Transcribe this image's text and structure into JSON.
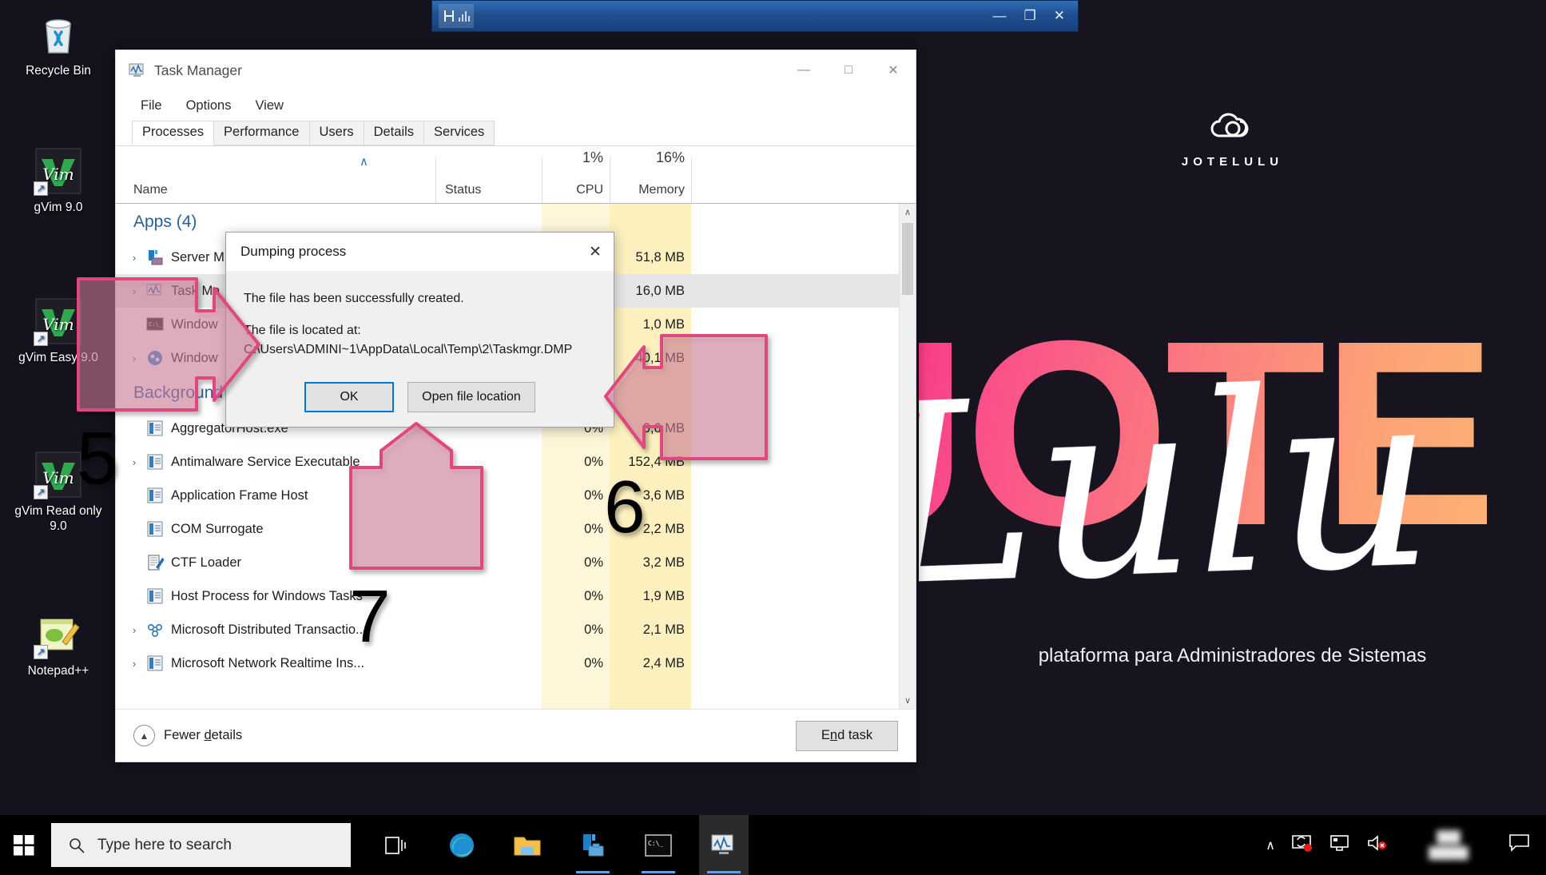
{
  "desktop": {
    "icons": [
      {
        "label": "Recycle Bin",
        "icon": "recycle-bin-icon",
        "shortcut": false
      },
      {
        "label": "gVim 9.0",
        "icon": "gvim-icon",
        "shortcut": true
      },
      {
        "label": "gVim Easy 9.0",
        "icon": "gvim-icon",
        "shortcut": true
      },
      {
        "label": "gVim Read only 9.0",
        "icon": "gvim-icon",
        "shortcut": true
      },
      {
        "label": "Notepad++",
        "icon": "notepadpp-icon",
        "shortcut": true
      }
    ],
    "wallpaper": {
      "brand": "JOTELULU",
      "word_back": "JOTE",
      "word_script": "Lulu",
      "tagline": "plataforma para Administradores de Sistemas",
      "colors": {
        "bg": "#17141f",
        "pink": "#f3237f",
        "peach": "#fdb273"
      }
    }
  },
  "background_window": {
    "title": "",
    "minimize": "—",
    "restore": "❐",
    "close": "✕"
  },
  "task_manager": {
    "title": "Task Manager",
    "window_buttons": {
      "minimize": "—",
      "maximize": "□",
      "close": "✕"
    },
    "menus": [
      "File",
      "Options",
      "View"
    ],
    "tabs": [
      {
        "label": "Processes",
        "active": true
      },
      {
        "label": "Performance",
        "active": false
      },
      {
        "label": "Users",
        "active": false
      },
      {
        "label": "Details",
        "active": false
      },
      {
        "label": "Services",
        "active": false
      }
    ],
    "columns": {
      "name": "Name",
      "status": "Status",
      "cpu": "CPU",
      "memory": "Memory",
      "cpu_total": "1%",
      "memory_total": "16%",
      "sort_indicator": "∧"
    },
    "groups": [
      {
        "label": "Apps (4)"
      },
      {
        "label": "Background p"
      }
    ],
    "apps": [
      {
        "name": "Server M",
        "expand": true,
        "status": "",
        "cpu": "%",
        "memory": "51,8 MB",
        "icon": "server-manager-icon",
        "selected": false
      },
      {
        "name": "Task Ma",
        "expand": true,
        "status": "",
        "cpu": "%",
        "memory": "16,0 MB",
        "icon": "task-manager-icon",
        "selected": true
      },
      {
        "name": "Window",
        "expand": false,
        "status": "",
        "cpu": "%",
        "memory": "1,0 MB",
        "icon": "console-icon",
        "selected": false
      },
      {
        "name": "Window",
        "expand": true,
        "status": "",
        "cpu": "%",
        "memory": "40,1 MB",
        "icon": "powershell-ise-icon",
        "selected": false
      }
    ],
    "background_processes": [
      {
        "name": "AggregatorHost.exe",
        "expand": false,
        "status": "",
        "cpu": "0%",
        "memory": "0,6 MB",
        "icon": "generic-app-icon"
      },
      {
        "name": "Antimalware Service Executable",
        "expand": true,
        "status": "",
        "cpu": "0%",
        "memory": "152,4 MB",
        "icon": "generic-app-icon"
      },
      {
        "name": "Application Frame Host",
        "expand": false,
        "status": "",
        "cpu": "0%",
        "memory": "3,6 MB",
        "icon": "generic-app-icon"
      },
      {
        "name": "COM Surrogate",
        "expand": false,
        "status": "",
        "cpu": "0%",
        "memory": "2,2 MB",
        "icon": "generic-app-icon"
      },
      {
        "name": "CTF Loader",
        "expand": false,
        "status": "",
        "cpu": "0%",
        "memory": "3,2 MB",
        "icon": "ctf-loader-icon"
      },
      {
        "name": "Host Process for Windows Tasks",
        "expand": false,
        "status": "",
        "cpu": "0%",
        "memory": "1,9 MB",
        "icon": "generic-app-icon"
      },
      {
        "name": "Microsoft Distributed Transactio...",
        "expand": true,
        "status": "",
        "cpu": "0%",
        "memory": "2,1 MB",
        "icon": "msdtc-icon"
      },
      {
        "name": "Microsoft Network Realtime Ins...",
        "expand": true,
        "status": "",
        "cpu": "0%",
        "memory": "2,4 MB",
        "icon": "generic-app-icon"
      }
    ],
    "footer": {
      "fewer_details": "Fewer details",
      "fewer_details_pre": "Fewer ",
      "fewer_details_accel": "d",
      "fewer_details_post": "etails",
      "end_task_pre": "E",
      "end_task_accel": "n",
      "end_task_post": "d task",
      "end_task": "End task"
    },
    "scrollbar": {
      "up": "∧",
      "down": "∨"
    }
  },
  "dialog": {
    "title": "Dumping process",
    "close": "✕",
    "line1": "The file has been successfully created.",
    "line2": "The file is located at:",
    "path": "C:\\Users\\ADMINI~1\\AppData\\Local\\Temp\\2\\Taskmgr.DMP",
    "ok_button": "OK",
    "open_location_button": "Open file location"
  },
  "annotations": [
    {
      "number": "5",
      "direction": "right",
      "target": "apps-process-list"
    },
    {
      "number": "6",
      "direction": "left",
      "target": "open-file-location-button"
    },
    {
      "number": "7",
      "direction": "up",
      "target": "ok-button"
    }
  ],
  "taskbar": {
    "start": "start-button",
    "search_placeholder": "Type here to search",
    "items": [
      {
        "name": "task-view-icon",
        "active": false,
        "running": false
      },
      {
        "name": "microsoft-edge-icon",
        "active": false,
        "running": false
      },
      {
        "name": "file-explorer-icon",
        "active": false,
        "running": true
      },
      {
        "name": "server-manager-icon",
        "active": false,
        "running": true
      },
      {
        "name": "command-prompt-icon",
        "active": false,
        "running": true
      },
      {
        "name": "task-manager-icon",
        "active": true,
        "running": true
      }
    ],
    "tray": {
      "show_hidden": "∧",
      "icons": [
        "network-sync-icon",
        "remote-desktop-icon",
        "volume-muted-icon"
      ],
      "clock_blurred": "",
      "action_center": "notification-icon"
    }
  }
}
